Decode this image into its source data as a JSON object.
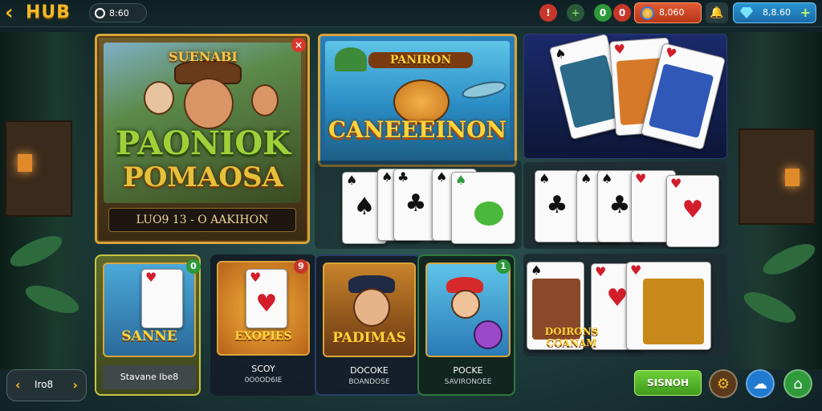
{
  "topbar": {
    "title": "HUB",
    "clock_value": "8:60",
    "coins": "8,060",
    "gems": "8,8.60",
    "back_icon": "chevron-left-icon",
    "add_icon": "plus-icon"
  },
  "featured": {
    "big": {
      "banner": "SUENABI",
      "title_line1": "PAONIOK",
      "title_line2": "POMAOSA",
      "subtitle": "LUO9 13 - O AAKIHON"
    },
    "wide": {
      "banner": "PANIRON",
      "title": "CANEEEINON"
    }
  },
  "games": [
    {
      "art_title": "SANNE",
      "label": "Stavane Ibe8",
      "sub": "",
      "badge": "0"
    },
    {
      "art_title": "EXOPIES",
      "label": "SCOY",
      "sub": "0O0OD6IE",
      "badge": "9"
    },
    {
      "art_title": "PADIMAS",
      "label": "DOCOKE",
      "sub": "BOANDOSE",
      "badge": ""
    },
    {
      "art_title": "",
      "label": "POCKE",
      "sub": "SAVIRONOEE",
      "badge": "1"
    }
  ],
  "right_card_panel": {
    "art_title": "DOIRONS COANAM"
  },
  "card_ranks": {
    "spade": "♠",
    "club": "♣",
    "heart": "♥"
  },
  "pager": {
    "label": "Iro8"
  },
  "bottom": {
    "action_label": "SISNOH"
  },
  "colors": {
    "gold": "#f4b828",
    "accent_green": "#6ecf3a",
    "coin_red": "#e15a34",
    "gem_blue": "#2a94d2"
  }
}
